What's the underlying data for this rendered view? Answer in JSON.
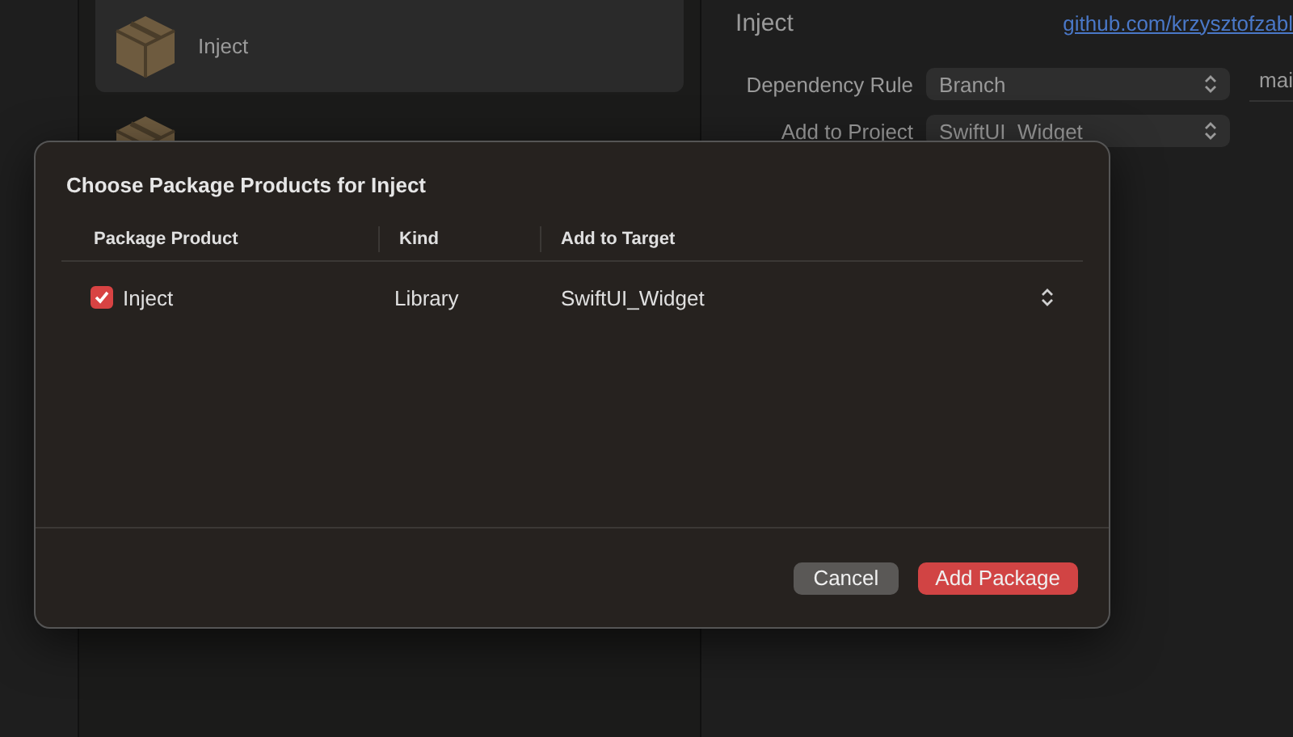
{
  "packages": [
    {
      "name": "Inject",
      "selected": true
    },
    {
      "selected": false
    }
  ],
  "detail": {
    "name": "Inject",
    "link": "github.com/krzysztofzabl",
    "rows": [
      {
        "label": "Dependency Rule",
        "value": "Branch",
        "extra": "mai"
      },
      {
        "label": "Add to Project",
        "value": "SwiftUI_Widget"
      }
    ]
  },
  "dialog": {
    "title": "Choose Package Products for Inject",
    "columns": [
      "Package Product",
      "Kind",
      "Add to Target"
    ],
    "rows": [
      {
        "product": "Inject",
        "checked": true,
        "kind": "Library",
        "target": "SwiftUI_Widget"
      }
    ],
    "buttons": [
      {
        "label": "Cancel",
        "kind": "secondary"
      },
      {
        "label": "Add Package",
        "kind": "primary"
      }
    ]
  }
}
